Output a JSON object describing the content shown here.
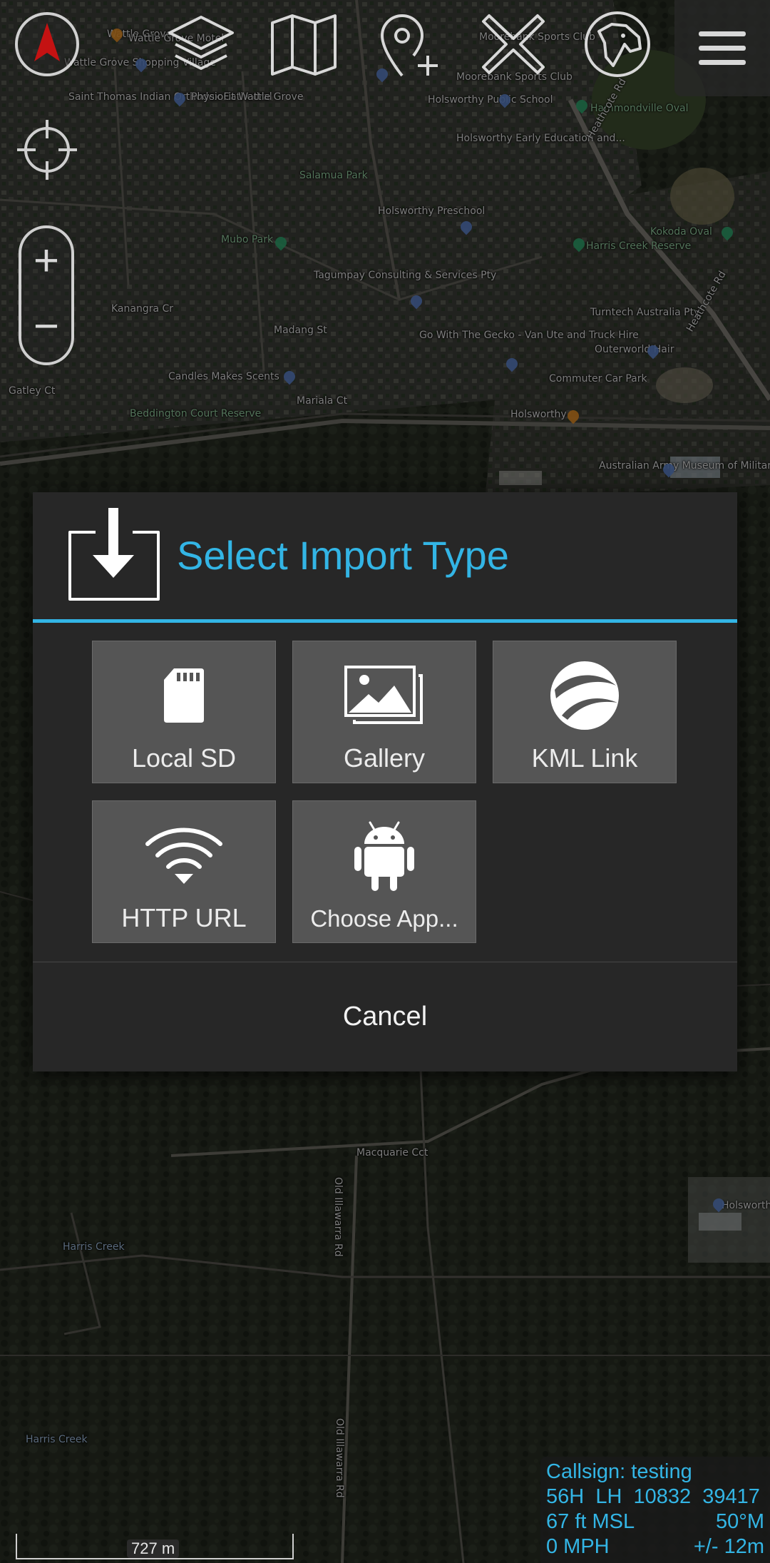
{
  "map": {
    "labels": [
      {
        "text": "Wattle Grove",
        "cls": ""
      },
      {
        "text": "Wattle Grove Shopping Village",
        "cls": ""
      },
      {
        "text": "Wattle Grove Motel",
        "cls": ""
      },
      {
        "text": "Saint Thomas Indian Orthodox Cathedral",
        "cls": ""
      },
      {
        "text": "PhysioFit Wattle Grove",
        "cls": ""
      },
      {
        "text": "Moorebank Sports Club",
        "cls": ""
      },
      {
        "text": "Moorebank Sports Club",
        "cls": ""
      },
      {
        "text": "Holsworthy Public School",
        "cls": ""
      },
      {
        "text": "Hammondville Oval",
        "cls": "park"
      },
      {
        "text": "Holsworthy Early Education and...",
        "cls": ""
      },
      {
        "text": "Salamua Park",
        "cls": "park"
      },
      {
        "text": "Holsworthy Preschool",
        "cls": ""
      },
      {
        "text": "Mubo Park",
        "cls": "park"
      },
      {
        "text": "Kokoda Oval",
        "cls": "park"
      },
      {
        "text": "Harris Creek Reserve",
        "cls": "park"
      },
      {
        "text": "Tagumpay Consulting & Services Pty",
        "cls": ""
      },
      {
        "text": "Turntech Australia Pty",
        "cls": ""
      },
      {
        "text": "Go With The Gecko - Van Ute and Truck Hire",
        "cls": ""
      },
      {
        "text": "Outerworld Hair",
        "cls": ""
      },
      {
        "text": "Candles Makes Scents",
        "cls": ""
      },
      {
        "text": "Commuter Car Park",
        "cls": ""
      },
      {
        "text": "Beddington Court Reserve",
        "cls": "park"
      },
      {
        "text": "Holsworthy",
        "cls": ""
      },
      {
        "text": "Australian Army Museum of Military...",
        "cls": ""
      },
      {
        "text": "Macquarie Cct",
        "cls": ""
      },
      {
        "text": "Harris Creek",
        "cls": "water"
      },
      {
        "text": "Harris Creek",
        "cls": "water"
      },
      {
        "text": "Old Illawarra Rd",
        "cls": ""
      },
      {
        "text": "Old Illawarra Rd",
        "cls": ""
      },
      {
        "text": "Holsworth",
        "cls": ""
      },
      {
        "text": "Heathcote Rd",
        "cls": ""
      },
      {
        "text": "Heathcote Rd",
        "cls": ""
      },
      {
        "text": "Madang St",
        "cls": ""
      },
      {
        "text": "Kanangra Cr",
        "cls": ""
      },
      {
        "text": "Mariala Ct",
        "cls": ""
      },
      {
        "text": "Gatley Ct",
        "cls": ""
      }
    ]
  },
  "toolbar": {
    "compass": "compass-arrow-icon",
    "layers": "layers-icon",
    "map": "folded-map-icon",
    "add_point": "add-location-pin-icon",
    "close": "close-icon",
    "dog": "dog-head-icon",
    "menu": "hamburger-menu-icon"
  },
  "side_controls": {
    "locate": "crosshair-icon",
    "zoom_in_label": "+",
    "zoom_out_label": "−"
  },
  "dialog": {
    "title": "Select Import Type",
    "title_icon": "import-download-icon",
    "options": [
      {
        "label": "Local SD",
        "icon": "sd-card-icon"
      },
      {
        "label": "Gallery",
        "icon": "gallery-image-icon"
      },
      {
        "label": "KML Link",
        "icon": "google-earth-icon"
      },
      {
        "label": "HTTP URL",
        "icon": "wifi-icon"
      },
      {
        "label": "Choose App...",
        "icon": "android-icon"
      }
    ],
    "cancel_label": "Cancel",
    "accent_color": "#33b5e5"
  },
  "status": {
    "callsign": "Callsign: testing",
    "grid": "56H  LH  10832  39417",
    "altitude": "67 ft MSL",
    "heading": "50°M",
    "speed": "0 MPH",
    "accuracy": "+/- 12m"
  },
  "scale": {
    "label": "727 m"
  }
}
